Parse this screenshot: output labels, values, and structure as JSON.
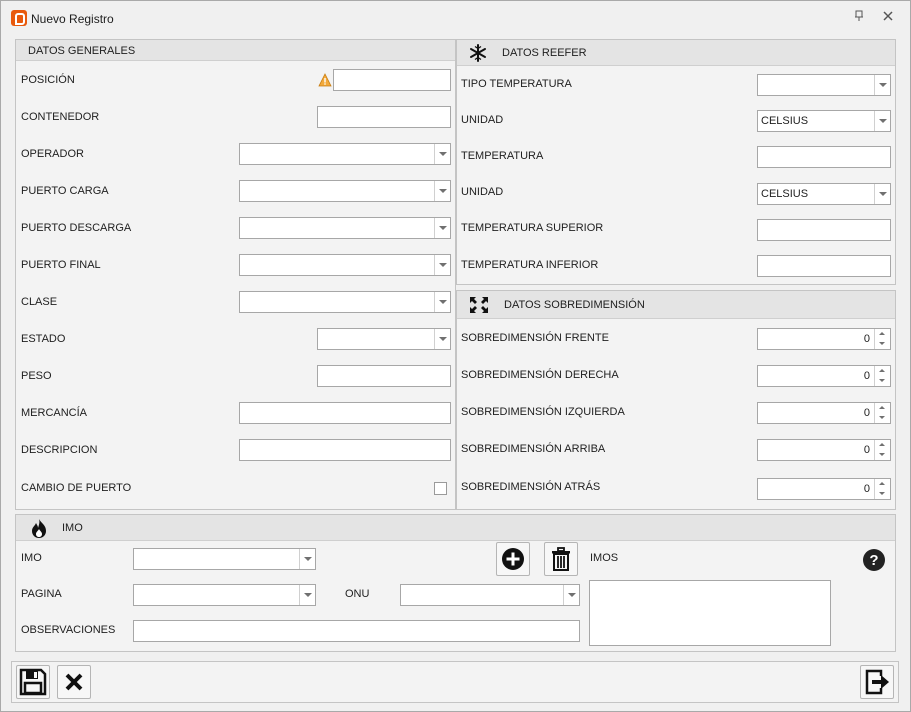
{
  "window": {
    "title": "Nuevo Registro"
  },
  "generales": {
    "header": "DATOS GENERALES",
    "posicion": "POSICIÓN",
    "contenedor": "CONTENEDOR",
    "operador": "OPERADOR",
    "puerto_carga": "PUERTO CARGA",
    "puerto_descarga": "PUERTO DESCARGA",
    "puerto_final": "PUERTO FINAL",
    "clase": "CLASE",
    "estado": "ESTADO",
    "peso": "PESO",
    "mercancia": "MERCANCÍA",
    "descripcion": "DESCRIPCION",
    "cambio_puerto": "CAMBIO DE PUERTO"
  },
  "reefer": {
    "header": "DATOS REEFER",
    "tipo_temperatura": "TIPO TEMPERATURA",
    "unidad1": "UNIDAD",
    "unidad1_value": "CELSIUS",
    "temperatura": "TEMPERATURA",
    "unidad2": "UNIDAD",
    "unidad2_value": "CELSIUS",
    "temp_superior": "TEMPERATURA SUPERIOR",
    "temp_inferior": "TEMPERATURA INFERIOR"
  },
  "sobre": {
    "header": "DATOS SOBREDIMENSIÓN",
    "frente": "SOBREDIMENSIÓN FRENTE",
    "frente_value": "0",
    "derecha": "SOBREDIMENSIÓN DERECHA",
    "derecha_value": "0",
    "izquierda": "SOBREDIMENSIÓN IZQUIERDA",
    "izquierda_value": "0",
    "arriba": "SOBREDIMENSIÓN ARRIBA",
    "arriba_value": "0",
    "atras": "SOBREDIMENSIÓN ATRÁS",
    "atras_value": "0"
  },
  "imo": {
    "header": "IMO",
    "imo": "IMO",
    "pagina": "PAGINA",
    "onu": "ONU",
    "observaciones": "OBSERVACIONES",
    "imos": "IMOS"
  },
  "colors": {
    "warning": "#f2a93b",
    "brand": "#e8590c"
  }
}
